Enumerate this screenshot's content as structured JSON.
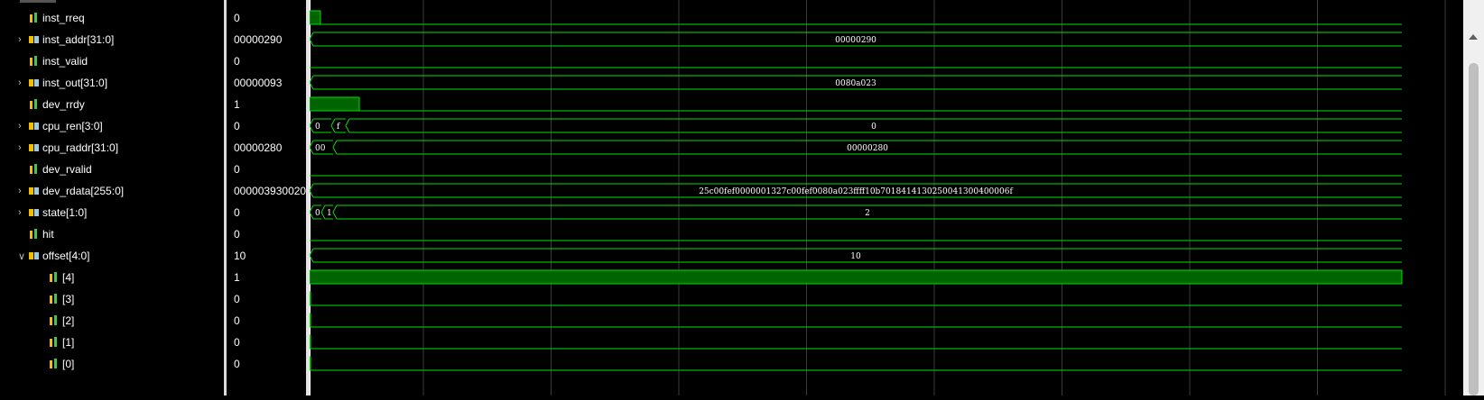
{
  "signals": [
    {
      "name": "inst_rreq",
      "value": "0",
      "expander": "",
      "icon": "bit-signal-icon",
      "wave": {
        "type": "bit",
        "segments": [
          [
            0,
            12,
            1
          ]
        ]
      }
    },
    {
      "name": "inst_addr[31:0]",
      "value": "00000290",
      "expander": ">",
      "icon": "bus-signal-icon",
      "wave": {
        "type": "bus",
        "changes": [
          0
        ],
        "labels": [
          "00000290"
        ]
      }
    },
    {
      "name": "inst_valid",
      "value": "0",
      "expander": "",
      "icon": "bit-signal-icon",
      "wave": {
        "type": "bit",
        "segments": []
      }
    },
    {
      "name": "inst_out[31:0]",
      "value": "00000093",
      "expander": ">",
      "icon": "bus-signal-icon",
      "wave": {
        "type": "bus",
        "changes": [
          0
        ],
        "labels": [
          "0080a023"
        ]
      }
    },
    {
      "name": "dev_rrdy",
      "value": "1",
      "expander": "",
      "icon": "bit-signal-icon",
      "wave": {
        "type": "bit",
        "segments": [
          [
            0,
            55,
            1
          ]
        ]
      }
    },
    {
      "name": "cpu_ren[3:0]",
      "value": "0",
      "expander": ">",
      "icon": "bus-signal-icon",
      "wave": {
        "type": "bus",
        "changes": [
          0,
          24,
          40
        ],
        "labels": [
          "0",
          "f",
          "0"
        ]
      }
    },
    {
      "name": "cpu_raddr[31:0]",
      "value": "00000280",
      "expander": ">",
      "icon": "bus-signal-icon",
      "wave": {
        "type": "bus",
        "changes": [
          0,
          26
        ],
        "labels": [
          "00",
          "00000280"
        ]
      }
    },
    {
      "name": "dev_rvalid",
      "value": "0",
      "expander": "",
      "icon": "bit-signal-icon",
      "wave": {
        "type": "bit",
        "segments": []
      }
    },
    {
      "name": "dev_rdata[255:0]",
      "value": "000003930020",
      "expander": ">",
      "icon": "bus-signal-icon",
      "wave": {
        "type": "bus",
        "changes": [
          0
        ],
        "labels": [
          "25c00fef0000001327c00fef0080a023ffff10b7018414130250041300400006f"
        ]
      }
    },
    {
      "name": "state[1:0]",
      "value": "0",
      "expander": ">",
      "icon": "bus-signal-icon",
      "wave": {
        "type": "bus",
        "changes": [
          0,
          13,
          26
        ],
        "labels": [
          "0",
          "1",
          "2"
        ]
      }
    },
    {
      "name": "hit",
      "value": "0",
      "expander": "",
      "icon": "bit-signal-icon",
      "wave": {
        "type": "bit",
        "segments": []
      }
    },
    {
      "name": "offset[4:0]",
      "value": "10",
      "expander": "v",
      "icon": "bus-signal-icon",
      "wave": {
        "type": "bus",
        "changes": [
          0
        ],
        "labels": [
          "10"
        ]
      }
    },
    {
      "name": "[4]",
      "value": "1",
      "expander": "",
      "icon": "bit-signal-icon",
      "indent": true,
      "wave": {
        "type": "bit",
        "segments": [
          [
            0,
            1210,
            1
          ]
        ]
      }
    },
    {
      "name": "[3]",
      "value": "0",
      "expander": "",
      "icon": "bit-signal-icon",
      "indent": true,
      "wave": {
        "type": "bit",
        "segments": [
          [
            0,
            1,
            1
          ]
        ]
      }
    },
    {
      "name": "[2]",
      "value": "0",
      "expander": "",
      "icon": "bit-signal-icon",
      "indent": true,
      "wave": {
        "type": "bit",
        "segments": [
          [
            0,
            1,
            1
          ]
        ]
      }
    },
    {
      "name": "[1]",
      "value": "0",
      "expander": "",
      "icon": "bit-signal-icon",
      "indent": true,
      "wave": {
        "type": "bit",
        "segments": [
          [
            0,
            1,
            1
          ]
        ]
      }
    },
    {
      "name": "[0]",
      "value": "0",
      "expander": "",
      "icon": "bit-signal-icon",
      "indent": true,
      "wave": {
        "type": "bit",
        "segments": [
          [
            0,
            1,
            1
          ]
        ]
      }
    }
  ],
  "colors": {
    "wave": "#00e000",
    "fill": "#006400",
    "grid": "#3a3a3a",
    "text": "#ffffff",
    "bitIcon": "#f0c000",
    "busIcon": "#a0c8e0"
  }
}
